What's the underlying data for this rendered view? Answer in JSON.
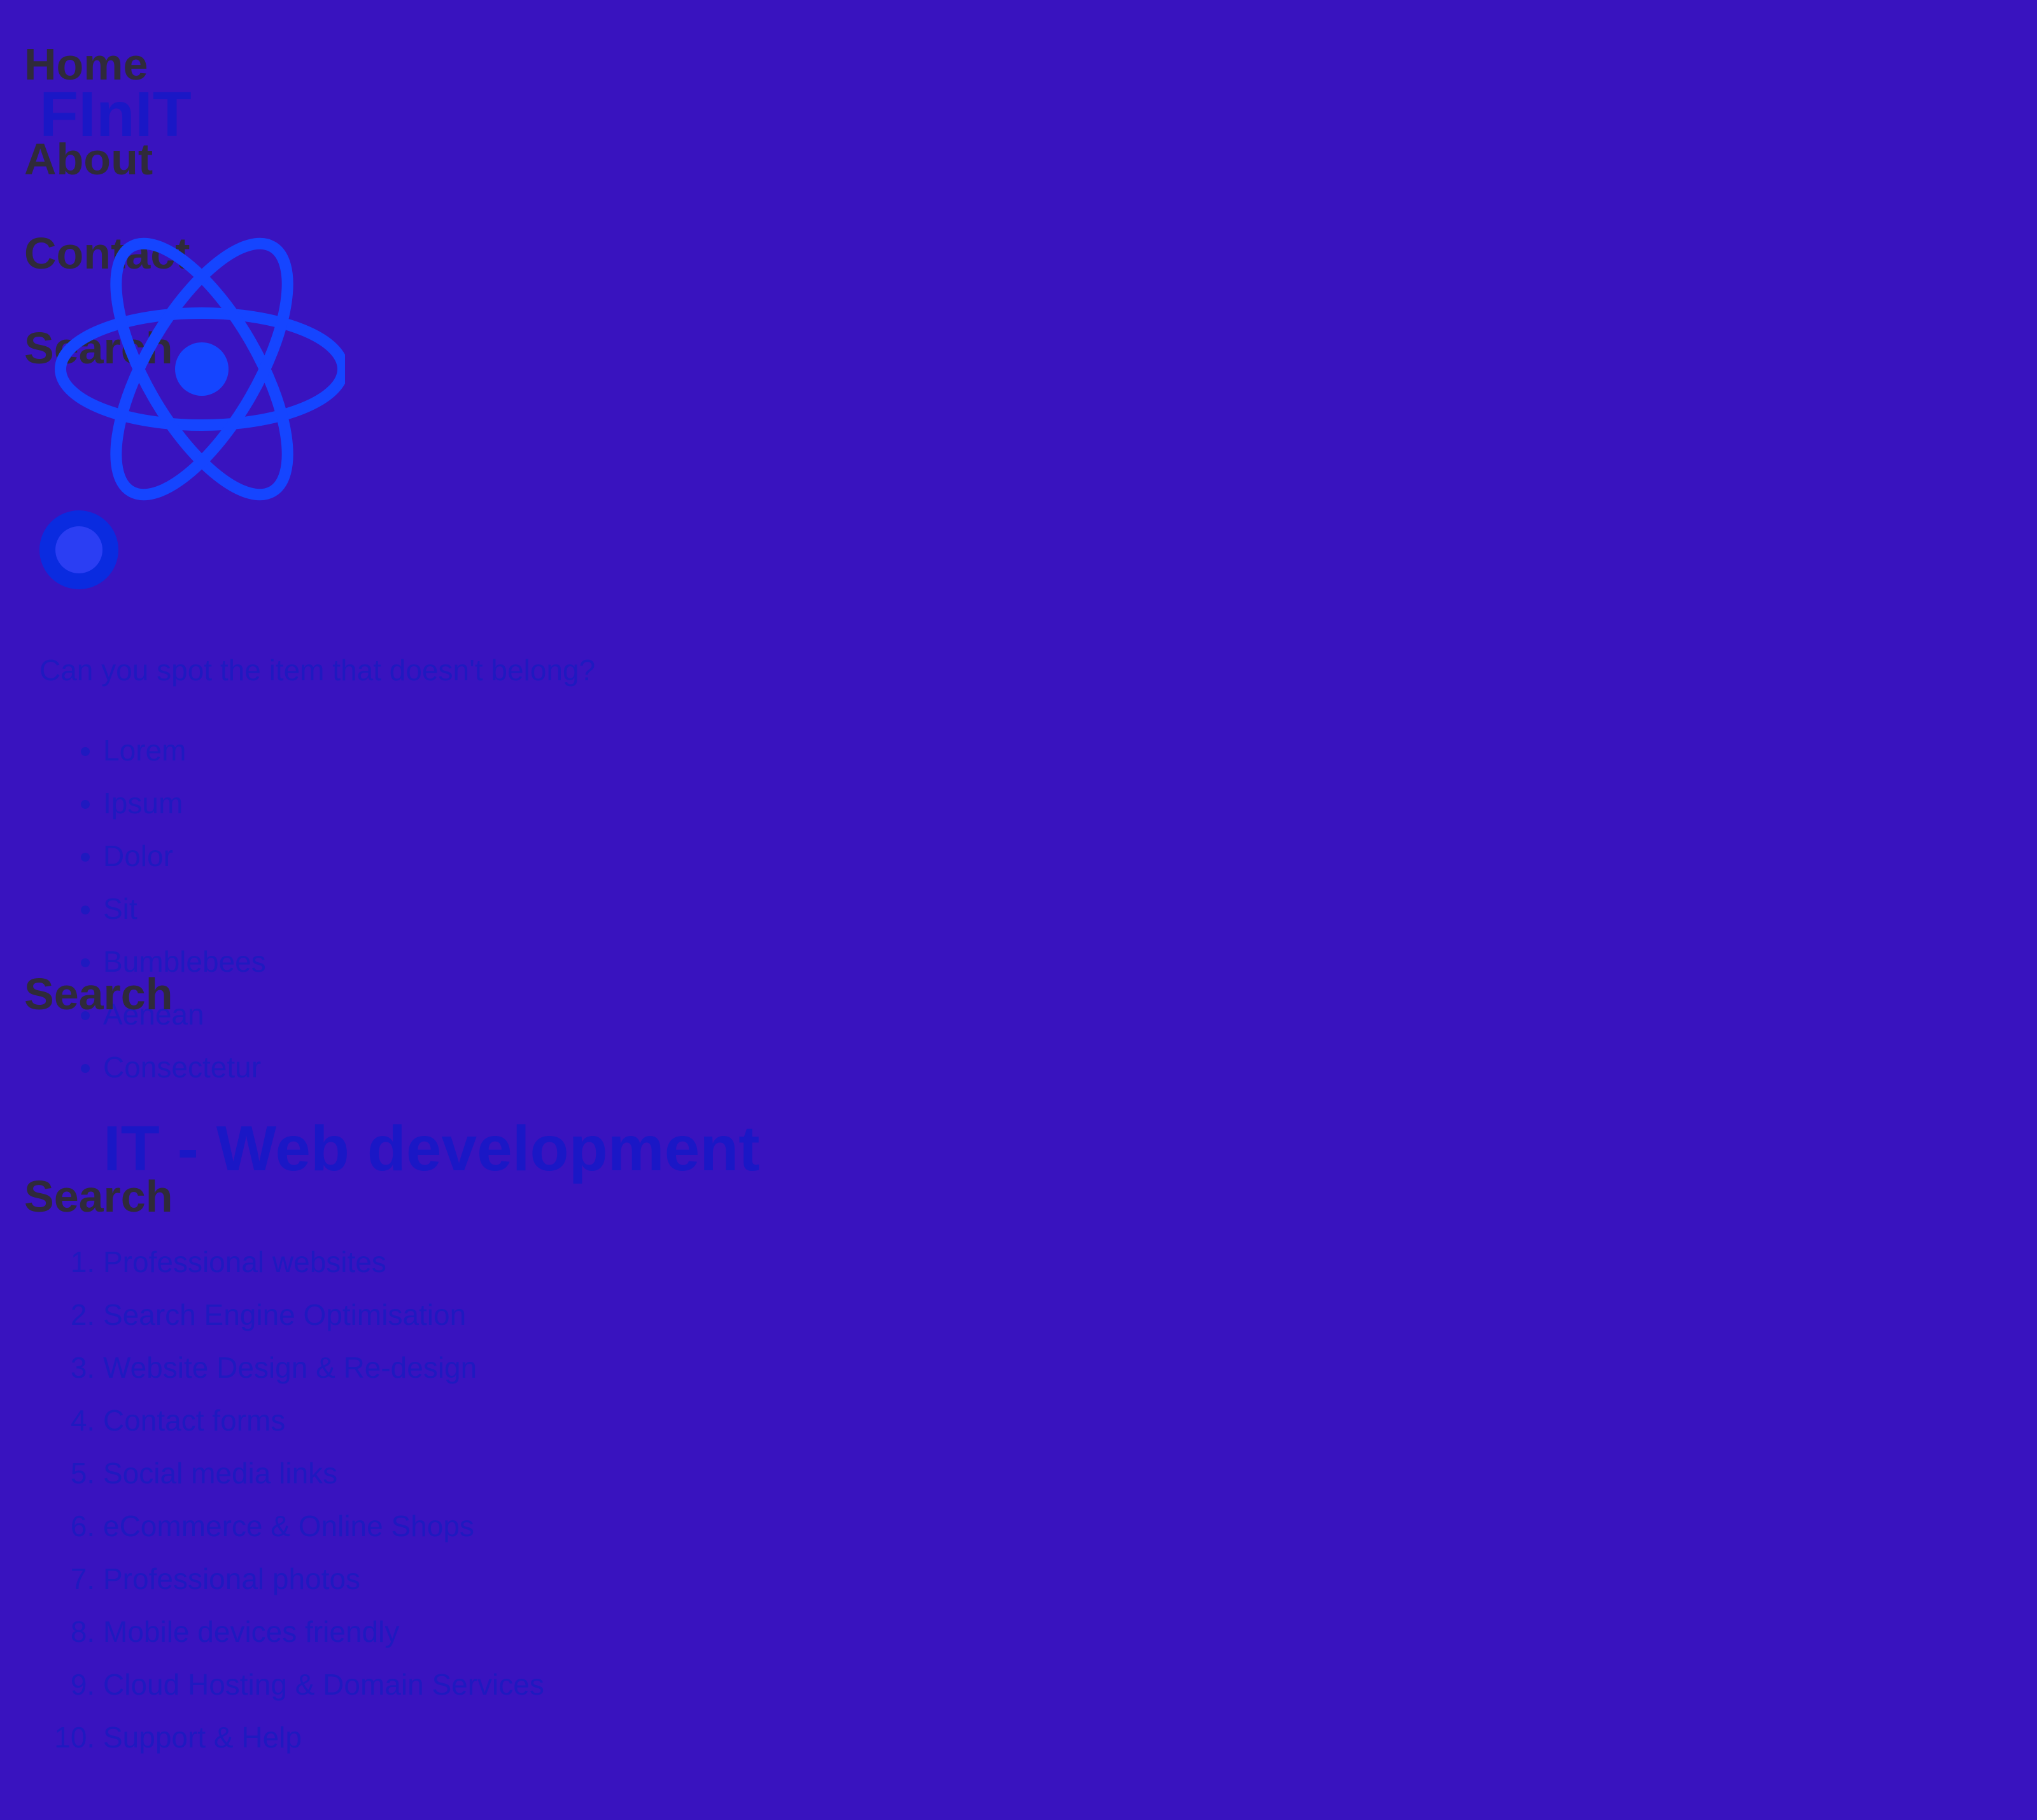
{
  "nav": {
    "home": "Home",
    "about": "About",
    "contact": "Contact",
    "search": "Search"
  },
  "extra_search_labels": [
    "Search",
    "Search"
  ],
  "brand": {
    "title": "FInIT",
    "logo_icon": "atom-icon",
    "dot_icon": "circle-icon"
  },
  "question": "Can you spot the item that doesn't belong?",
  "odd_list": [
    "Lorem",
    "Ipsum",
    "Dolor",
    "Sit",
    "Bumblebees",
    "Aenean",
    "Consectetur"
  ],
  "services": {
    "heading": "IT - Web development",
    "items": [
      "Professional websites",
      "Search Engine Optimisation",
      "Website Design & Re-design",
      "Contact forms",
      "Social media links",
      "eCommerce & Online Shops",
      "Professional photos",
      "Mobile devices friendly",
      "Cloud Hosting & Domain Services",
      "Support & Help"
    ]
  },
  "colors": {
    "background": "#3913bf",
    "nav_text": "#2f2a3a",
    "content_text": "#1f19c0",
    "accent_blue": "#1545ff"
  }
}
